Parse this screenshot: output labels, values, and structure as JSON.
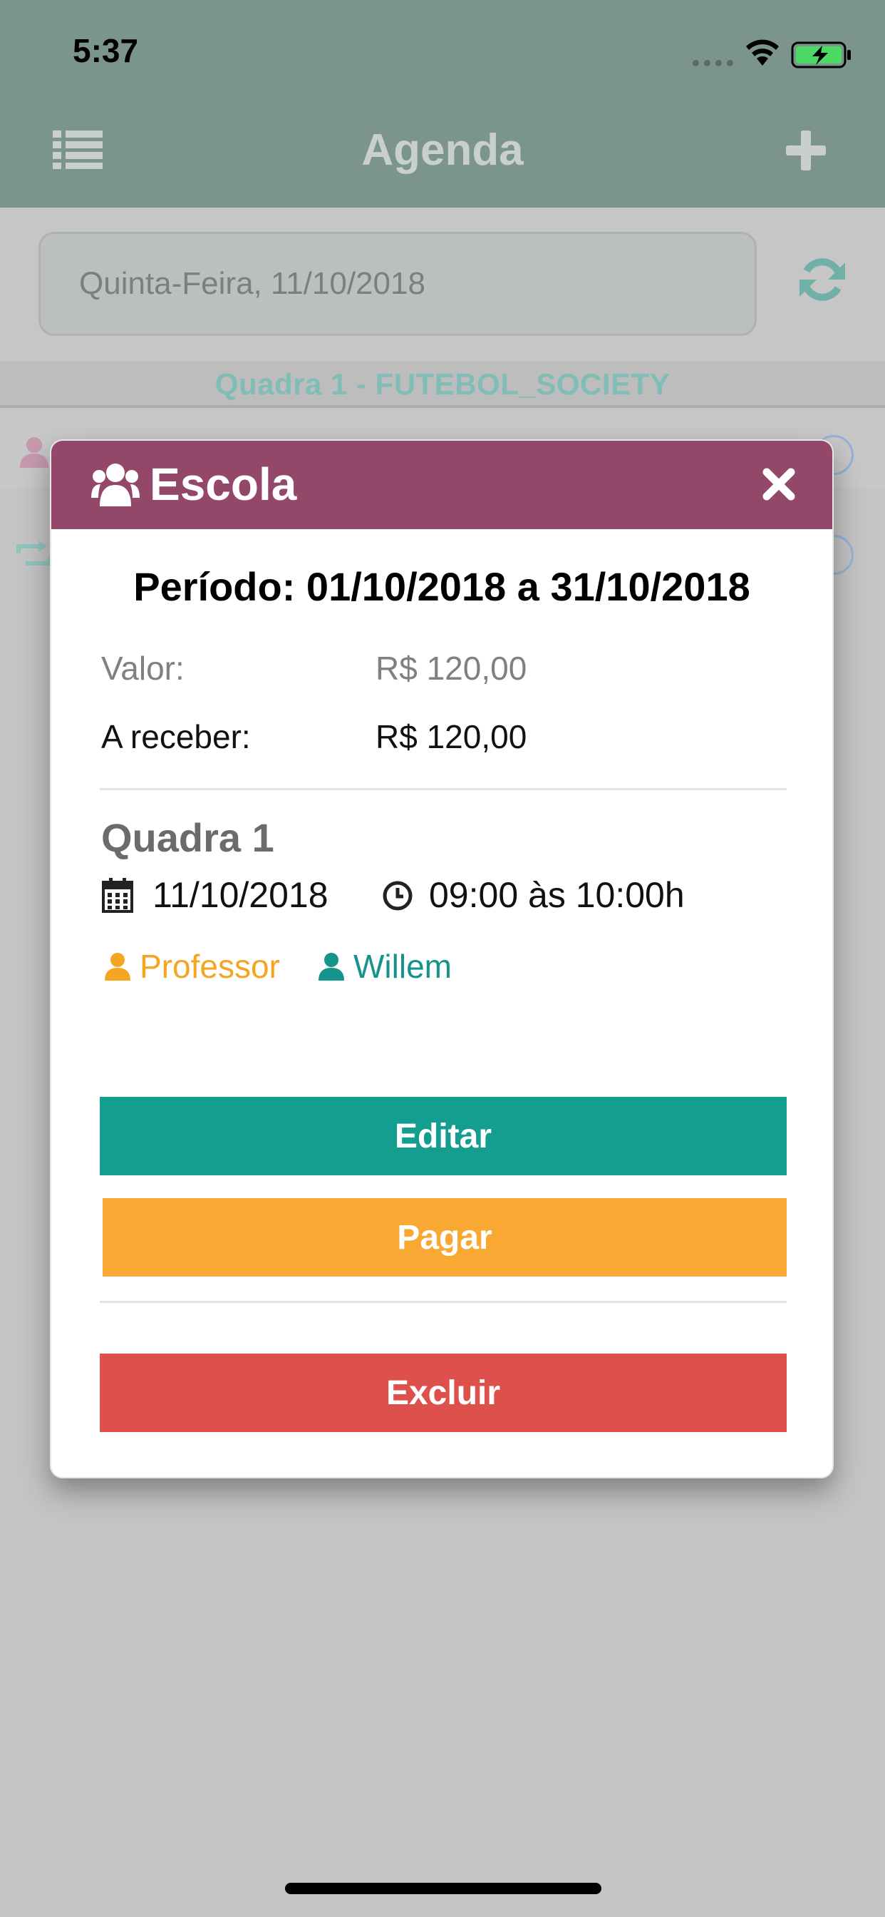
{
  "status_bar": {
    "time": "5:37"
  },
  "navbar": {
    "title": "Agenda",
    "menu_icon": "list-icon",
    "add_icon": "plus-icon"
  },
  "date_picker": {
    "value": "Quinta-Feira, 11/10/2018",
    "refresh_icon": "refresh-icon"
  },
  "court_section": {
    "header": "Quadra 1 - FUTEBOL_SOCIETY"
  },
  "modal": {
    "title": "Escola",
    "title_icon": "users-icon",
    "period": "Período: 01/10/2018 a 31/10/2018",
    "value_label": "Valor:",
    "value_amount": "R$ 120,00",
    "receivable_label": "A receber:",
    "receivable_amount": "R$ 120,00",
    "court_name": "Quadra 1",
    "date": "11/10/2018",
    "time": "09:00 às 10:00h",
    "teacher_label": "Professor",
    "student_name": "Willem",
    "edit_label": "Editar",
    "pay_label": "Pagar",
    "delete_label": "Excluir"
  },
  "colors": {
    "header_bg": "#7c958c",
    "modal_header": "#934869",
    "edit_button": "#149e8f",
    "pay_button": "#f9a834",
    "delete_button": "#de504c",
    "teacher_color": "#f5a524",
    "student_color": "#14948a"
  }
}
